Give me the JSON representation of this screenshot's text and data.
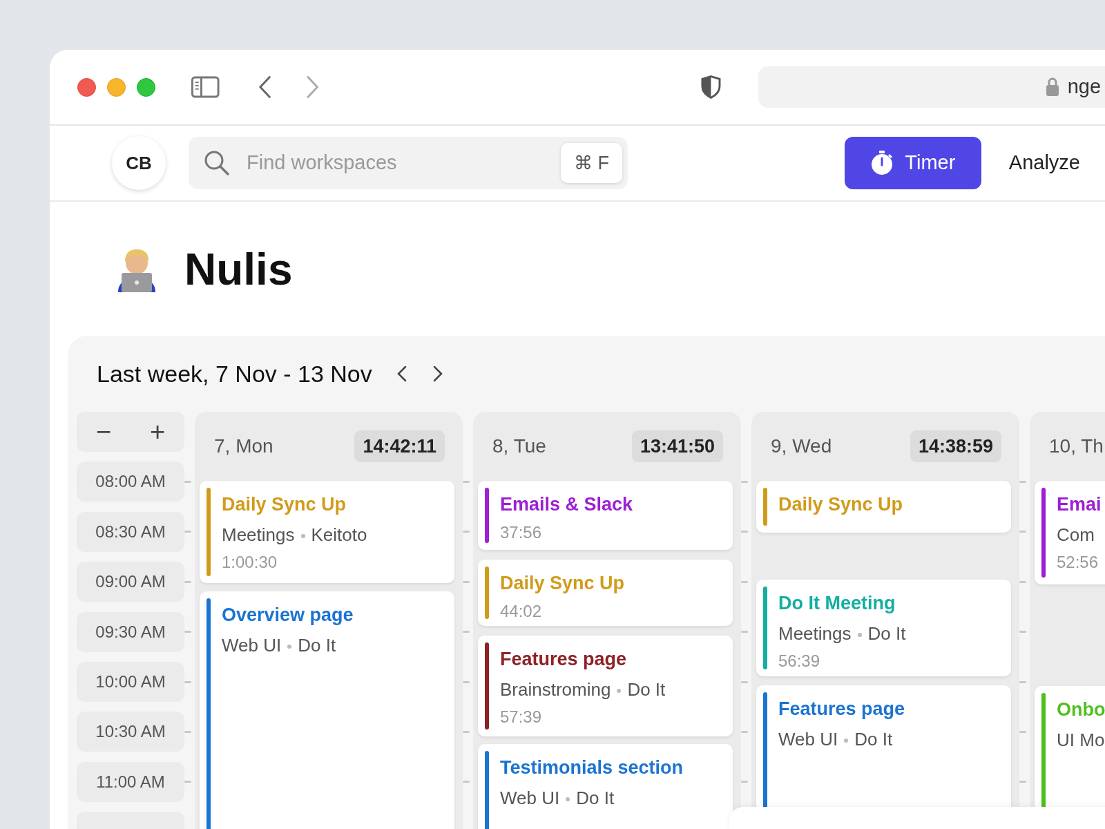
{
  "browser": {
    "address": "nge"
  },
  "header": {
    "avatar": "CB",
    "search": {
      "placeholder": "Find workspaces",
      "shortcut": "⌘ F"
    },
    "timer_button": "Timer",
    "analyze_link": "Analyze"
  },
  "workspace": {
    "title": "Nulis"
  },
  "week": {
    "title": "Last week, 7 Nov - 13 Nov"
  },
  "zoom_controls": [
    "−",
    "+"
  ],
  "times": [
    "08:00 AM",
    "08:30 AM",
    "09:00 AM",
    "09:30 AM",
    "10:00 AM",
    "10:30 AM",
    "11:00 AM"
  ],
  "days": [
    {
      "label": "7, Mon",
      "total": "14:42:11",
      "events": [
        {
          "title": "Daily Sync Up",
          "project": "Meetings",
          "client": "Keitoto",
          "duration": "1:00:30",
          "color": "#d19b1a"
        },
        {
          "title": "Overview page",
          "project": "Web UI",
          "client": "Do It",
          "color": "#1b74d1"
        }
      ]
    },
    {
      "label": "8, Tue",
      "total": "13:41:50",
      "events": [
        {
          "title": "Emails & Slack",
          "duration": "37:56",
          "color": "#9d1fd6"
        },
        {
          "title": "Daily Sync Up",
          "duration": "44:02",
          "color": "#d19b1a"
        },
        {
          "title": "Features page",
          "project": "Brainstroming",
          "client": "Do It",
          "duration": "57:39",
          "color": "#8e2126"
        },
        {
          "title": "Testimonials section",
          "project": "Web UI",
          "client": "Do It",
          "color": "#1b74d1"
        }
      ]
    },
    {
      "label": "9, Wed",
      "total": "14:38:59",
      "events": [
        {
          "title": "Daily Sync Up",
          "color": "#d19b1a"
        },
        {
          "title": "Do It Meeting",
          "project": "Meetings",
          "client": "Do It",
          "duration": "56:39",
          "color": "#13aea1"
        },
        {
          "title": "Features page",
          "project": "Web UI",
          "client": "Do It",
          "color": "#1b74d1"
        }
      ]
    },
    {
      "label": "10, Th",
      "events": [
        {
          "title": "Emai",
          "project": "Com",
          "duration": "52:56",
          "color": "#9d1fd6"
        },
        {
          "title": "Onbo",
          "project": "UI Mo",
          "color": "#4fbf1f"
        }
      ]
    }
  ]
}
